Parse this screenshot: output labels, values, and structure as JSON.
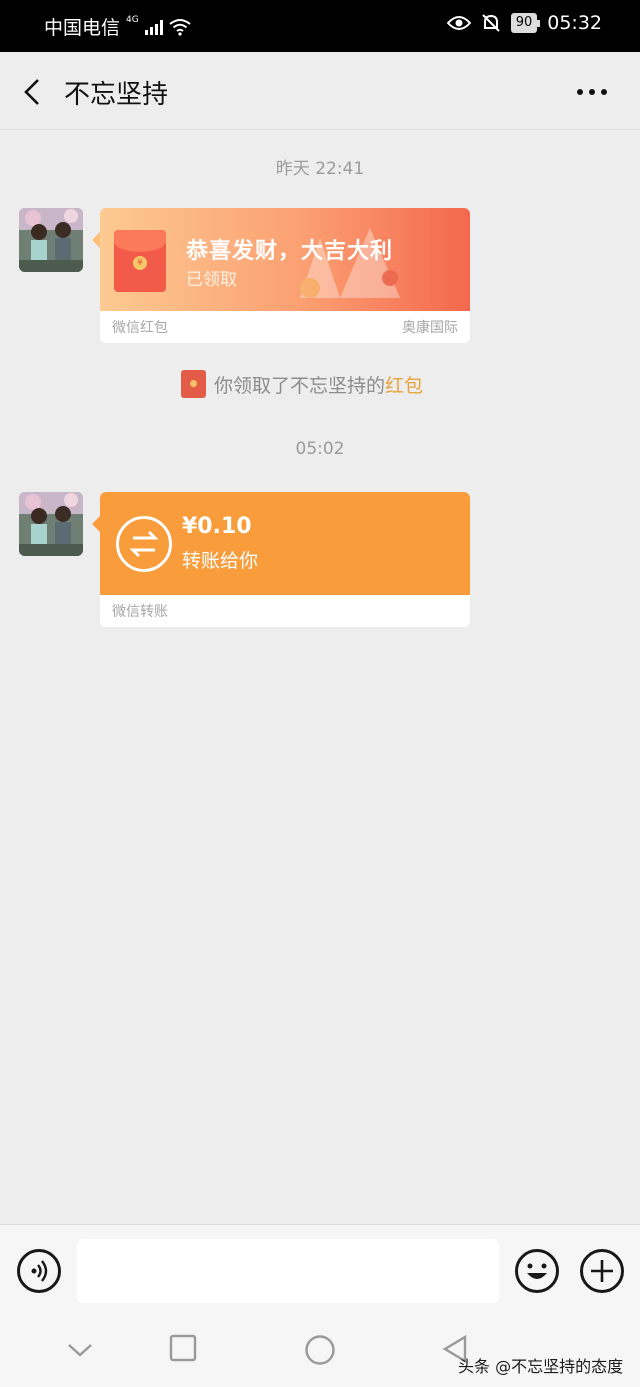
{
  "status_bar": {
    "carrier": "中国电信",
    "network": "4G",
    "battery": "90",
    "time": "05:32"
  },
  "nav": {
    "title": "不忘坚持",
    "back_icon": "chevron-left-icon",
    "more_icon": "more-dots-icon"
  },
  "chat": {
    "messages": [
      {
        "timestamp": "昨天 22:41",
        "type": "red_packet",
        "title": "恭喜发财，大吉大利",
        "status": "已领取",
        "footer_left": "微信红包",
        "footer_right": "奥康国际"
      },
      {
        "type": "system_notice",
        "prefix": "你领取了不忘坚持的",
        "link": "红包"
      },
      {
        "timestamp": "05:02",
        "type": "transfer",
        "amount": "¥0.10",
        "status": "转账给你",
        "footer_left": "微信转账"
      }
    ]
  },
  "input_bar": {
    "placeholder": "",
    "voice_icon": "voice-icon",
    "emoji_icon": "emoji-icon",
    "plus_icon": "plus-icon"
  },
  "watermark": "头条 @不忘坚持的态度",
  "colors": {
    "red_packet_orange": "#fb9f72",
    "transfer_orange": "#f99d3c",
    "link": "#e7a339"
  }
}
